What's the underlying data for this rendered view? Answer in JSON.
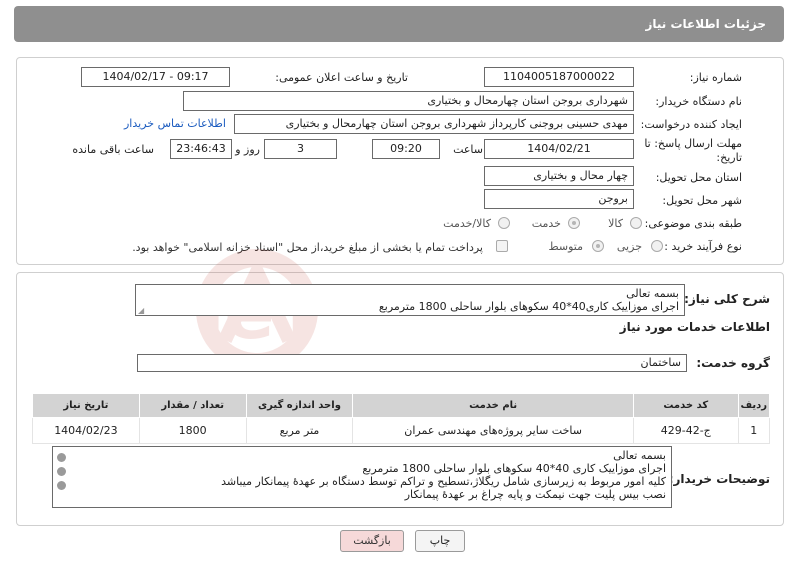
{
  "header": {
    "title": "جزئیات اطلاعات نیاز"
  },
  "need": {
    "number_label": "شماره نیاز:",
    "number_value": "1104005187000022",
    "announce_label": "تاریخ و ساعت اعلان عمومی:",
    "announce_value": "1404/02/17 - 09:17",
    "buyer_label": "نام دستگاه خریدار:",
    "buyer_value": "شهرداری بروجن استان چهارمحال و بختیاری",
    "creator_label": "ایجاد کننده درخواست:",
    "creator_value": "مهدی حسینی بروجنی کارپرداز شهرداری بروجن استان چهارمحال و بختیاری",
    "contact_link": "اطلاعات تماس خریدار",
    "deadline_label_1": "مهلت ارسال پاسخ: تا",
    "deadline_label_2": "تاریخ:",
    "deadline_date": "1404/02/21",
    "time_label": "ساعت",
    "deadline_time": "09:20",
    "days_value": "3",
    "days_label": "روز و",
    "remaining_value": "23:46:43",
    "remaining_label": "ساعت باقی مانده",
    "province_label": "استان محل تحویل:",
    "province_value": "چهار محال و بختیاری",
    "city_label": "شهر محل تحویل:",
    "city_value": "بروجن",
    "category_label": "طبقه بندی موضوعی:",
    "category_options": [
      "کالا",
      "خدمت",
      "کالا/خدمت"
    ],
    "process_label": "نوع فرآیند خرید :",
    "process_options": [
      "جزیی",
      "متوسط"
    ],
    "payment_note": "پرداخت تمام یا بخشی از مبلغ خرید،از محل \"اسناد خزانه اسلامی\" خواهد بود."
  },
  "summary": {
    "label": "شرح کلی نیاز:",
    "line1": "بسمه تعالی",
    "line2": "اجرای موزاییک کاری40*40 سکوهای بلوار ساحلی 1800 مترمربع"
  },
  "services": {
    "section_title": "اطلاعات خدمات مورد نیاز",
    "group_label": "گروه خدمت:",
    "group_value": "ساختمان",
    "columns": [
      "ردیف",
      "کد خدمت",
      "نام خدمت",
      "واحد اندازه گیری",
      "تعداد / مقدار",
      "تاریخ نیاز"
    ],
    "rows": [
      {
        "row": "1",
        "code": "ج-42-429",
        "name": "ساخت سایر پروژه‌های مهندسی عمران",
        "unit": "متر مربع",
        "qty": "1800",
        "date": "1404/02/23"
      }
    ]
  },
  "notes": {
    "label": "توضیحات خریدار:",
    "lines": [
      "بسمه تعالی",
      "اجرای موزاییک کاری 40*40 سکوهای بلوار ساحلی 1800 مترمربع",
      "کلیه امور مربوط به زیرسازی شامل ریگلاژ،تسطیح و تراکم توسط دستگاه بر عهدهٔ پیمانکار میباشد",
      "نصب بیس پلیت جهت نیمکت و پایه چراغ بر عهدهٔ پیمانکار"
    ]
  },
  "buttons": {
    "print": "چاپ",
    "back": "بازگشت"
  },
  "watermark_text": "AriaTender.neT",
  "colors": {
    "header": "#8f8f8f",
    "link": "#1b5bbf",
    "back_button": "#f6d9d9",
    "table_header": "#d3d3d3",
    "watermark": "#c0392b"
  }
}
